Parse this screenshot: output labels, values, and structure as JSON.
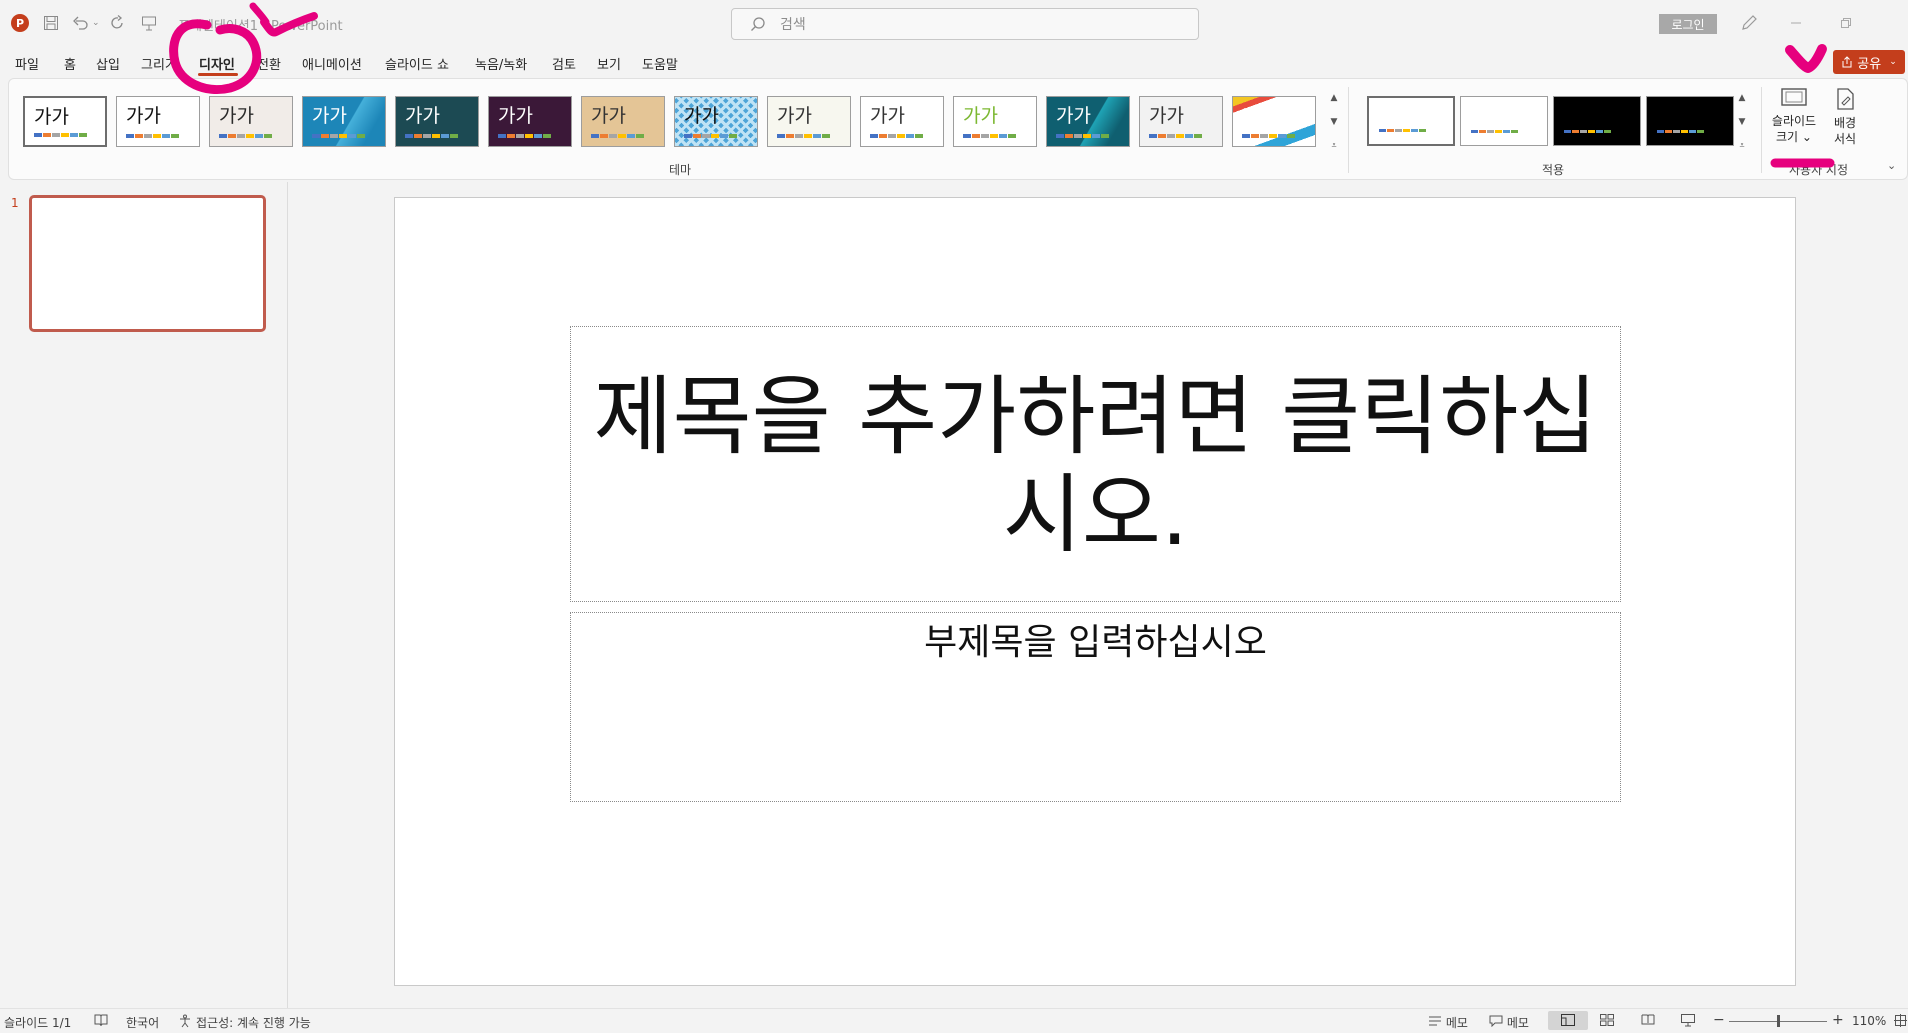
{
  "titlebar": {
    "app_logo": "P",
    "doc_title": "프레젠테이션1 - PowerPoint",
    "search_placeholder": "검색",
    "login_label": "로그인",
    "icons": [
      "save-icon",
      "undo-icon",
      "redo-icon",
      "present-icon",
      "pen-icon",
      "minimize-icon",
      "restore-icon"
    ]
  },
  "menu": {
    "items": [
      "파일",
      "홈",
      "삽입",
      "그리기",
      "디자인",
      "전환",
      "애니메이션",
      "슬라이드 쇼",
      "녹음/녹화",
      "검토",
      "보기",
      "도움말"
    ],
    "active": "디자인",
    "share_label": "공유"
  },
  "ribbon": {
    "themes_label": "테마",
    "variants_label": "적용",
    "customize_label": "사용자 지정",
    "theme_sample_text": "가가",
    "slide_size_label_1": "슬라이드",
    "slide_size_label_2": "크기",
    "bg_format_label_1": "배경",
    "bg_format_label_2": "서식",
    "themes": [
      {
        "bg": "#ffffff",
        "fg": "#111111",
        "accent": "#ffffff"
      },
      {
        "bg": "#ffffff",
        "fg": "#111111",
        "accent": "#ffffff"
      },
      {
        "bg": "#f1ece8",
        "fg": "#2a2a2a",
        "accent": "#b3483a"
      },
      {
        "bg": "#1d86b8",
        "fg": "#ffffff",
        "accent": "#45b0da"
      },
      {
        "bg": "#1c4a53",
        "fg": "#ffffff",
        "accent": "#c43e1c"
      },
      {
        "bg": "#3b1838",
        "fg": "#ffffff",
        "accent": "#c0306a"
      },
      {
        "bg": "#e4c596",
        "fg": "#333333",
        "accent": "#8a4a25"
      },
      {
        "bg": "#4ea5d8",
        "fg": "#111111",
        "accent": "#ffffff"
      },
      {
        "bg": "#f7f7ef",
        "fg": "#333333",
        "accent": "#8fbf4a"
      },
      {
        "bg": "#ffffff",
        "fg": "#333333",
        "accent": "#c4582a"
      },
      {
        "bg": "#ffffff",
        "fg": "#7cb832",
        "accent": "#7cb832"
      },
      {
        "bg": "#0f5f70",
        "fg": "#ffffff",
        "accent": "#1fa3b5"
      },
      {
        "bg": "#f2f2f2",
        "fg": "#333333",
        "accent": "#a37bb8"
      },
      {
        "bg": "#ffffff",
        "fg": "#ffffff",
        "accent": "#e84c3d"
      }
    ],
    "variants": [
      {
        "bg": "#ffffff"
      },
      {
        "bg": "#ffffff"
      },
      {
        "bg": "#000000"
      },
      {
        "bg": "#000000"
      }
    ],
    "bar_colors": [
      "#4472c4",
      "#ed7d31",
      "#a5a5a5",
      "#ffc000",
      "#5b9bd5",
      "#70ad47"
    ]
  },
  "slides_panel": {
    "slide_number": "1"
  },
  "slide": {
    "title_placeholder": "제목을 추가하려면 클릭하십시오.",
    "subtitle_placeholder": "부제목을 입력하십시오"
  },
  "status": {
    "slide_count": "슬라이드 1/1",
    "language": "한국어",
    "accessibility": "접근성: 계속 진행 가능",
    "notes_label": "메모",
    "comments_label": "메모",
    "zoom": "110%"
  },
  "accent_color": "#c43e1c",
  "annotation_color": "#e6007e"
}
